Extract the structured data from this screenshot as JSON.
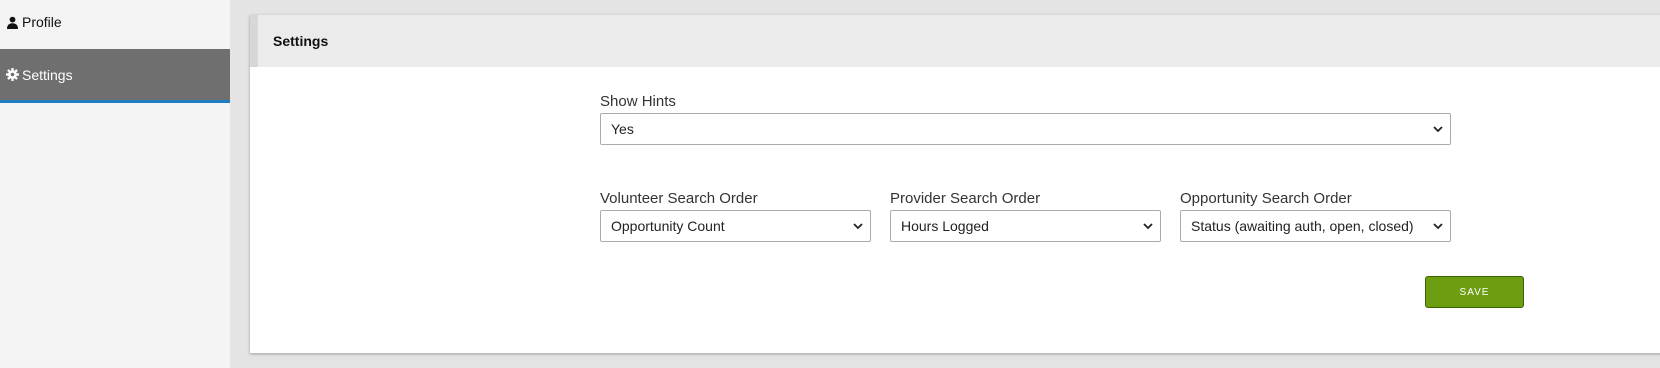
{
  "sidebar": {
    "items": [
      {
        "label": "Profile",
        "icon": "user-icon"
      },
      {
        "label": "Settings",
        "icon": "gear-icon",
        "active": true
      }
    ]
  },
  "panel": {
    "title": "Settings"
  },
  "form": {
    "show_hints": {
      "label": "Show Hints",
      "value": "Yes"
    },
    "volunteer_order": {
      "label": "Volunteer Search Order",
      "value": "Opportunity Count"
    },
    "provider_order": {
      "label": "Provider Search Order",
      "value": "Hours Logged"
    },
    "opportunity_order": {
      "label": "Opportunity Search Order",
      "value": "Status (awaiting auth, open, closed)"
    },
    "save_label": "SAVE"
  },
  "colors": {
    "active_sidebar": "#6f6f6f",
    "active_underline": "#1f7ec2",
    "save_button": "#6d9d10"
  }
}
